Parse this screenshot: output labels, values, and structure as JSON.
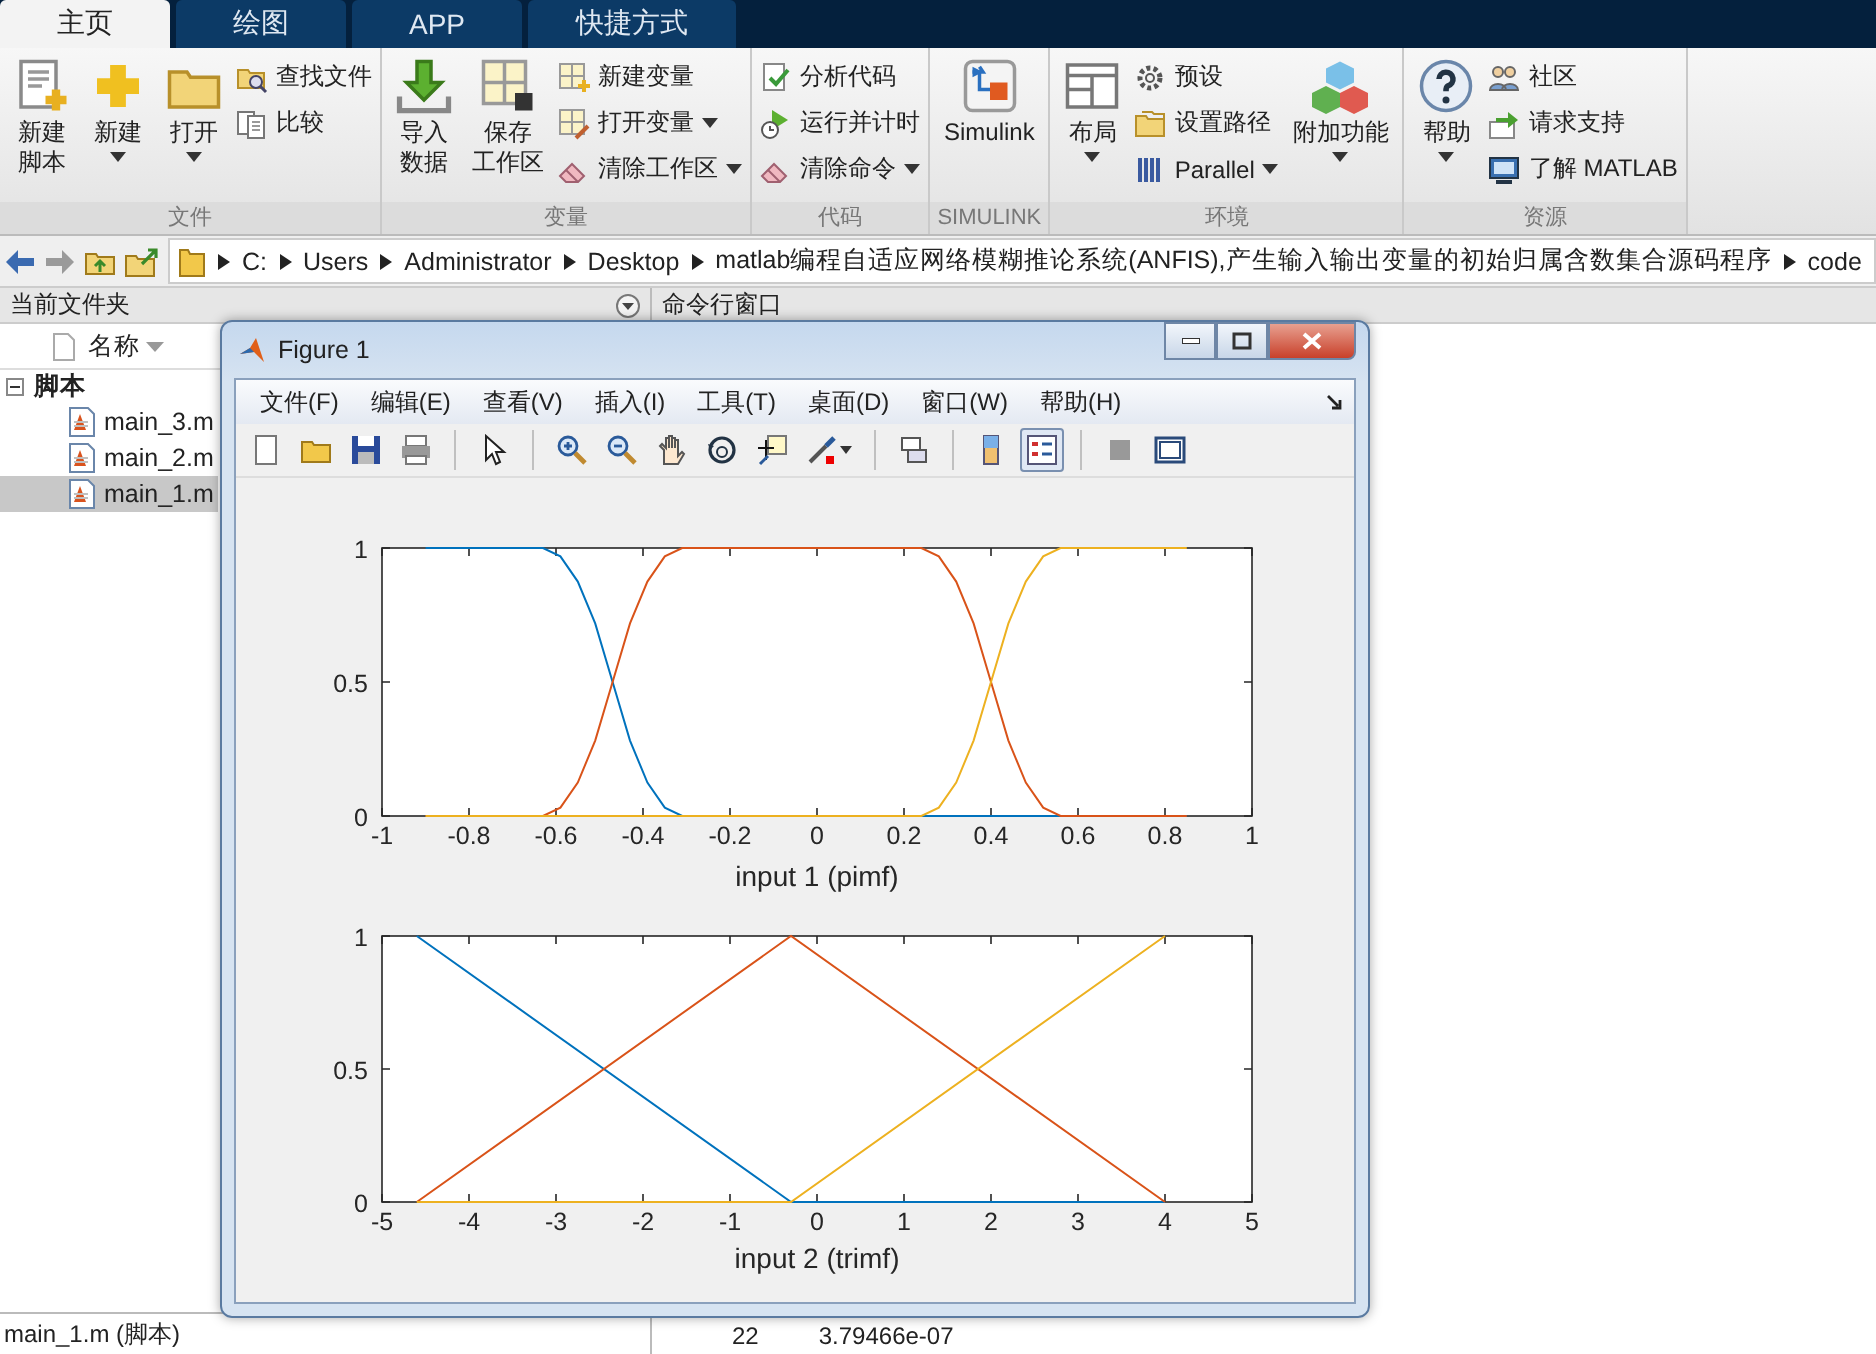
{
  "tabs": [
    {
      "label": "主页",
      "selected": true
    },
    {
      "label": "绘图",
      "selected": false
    },
    {
      "label": "APP",
      "selected": false
    },
    {
      "label": "快捷方式",
      "selected": false
    }
  ],
  "ribbon": [
    {
      "title": "文件",
      "columns": [
        {
          "kind": "large",
          "lines": [
            "新建",
            "脚本"
          ],
          "dropdown": false
        },
        {
          "kind": "large",
          "lines": [
            "新建"
          ],
          "dropdown": true
        },
        {
          "kind": "large",
          "lines": [
            "打开"
          ],
          "dropdown": true
        },
        {
          "kind": "stack",
          "items": [
            {
              "label": "查找文件",
              "dropdown": false
            },
            {
              "label": "比较",
              "dropdown": false
            }
          ]
        }
      ]
    },
    {
      "title": "变量",
      "columns": [
        {
          "kind": "large",
          "lines": [
            "导入",
            "数据"
          ],
          "dropdown": false
        },
        {
          "kind": "large",
          "lines": [
            "保存",
            "工作区"
          ],
          "dropdown": false
        },
        {
          "kind": "stack",
          "items": [
            {
              "label": "新建变量",
              "dropdown": false
            },
            {
              "label": "打开变量",
              "dropdown": true
            },
            {
              "label": "清除工作区",
              "dropdown": true
            }
          ]
        }
      ]
    },
    {
      "title": "代码",
      "columns": [
        {
          "kind": "stack",
          "items": [
            {
              "label": "分析代码",
              "dropdown": false
            },
            {
              "label": "运行并计时",
              "dropdown": false
            },
            {
              "label": "清除命令",
              "dropdown": true
            }
          ]
        }
      ]
    },
    {
      "title": "SIMULINK",
      "columns": [
        {
          "kind": "large",
          "lines": [
            "Simulink"
          ],
          "dropdown": false
        }
      ]
    },
    {
      "title": "环境",
      "columns": [
        {
          "kind": "large",
          "lines": [
            "布局"
          ],
          "dropdown": true
        },
        {
          "kind": "stack",
          "items": [
            {
              "label": "预设",
              "dropdown": false
            },
            {
              "label": "设置路径",
              "dropdown": false
            },
            {
              "label": "Parallel",
              "dropdown": true
            }
          ]
        },
        {
          "kind": "large",
          "lines": [
            "附加功能"
          ],
          "dropdown": true
        }
      ]
    },
    {
      "title": "资源",
      "columns": [
        {
          "kind": "large",
          "lines": [
            "帮助"
          ],
          "dropdown": true
        },
        {
          "kind": "stack",
          "items": [
            {
              "label": "社区",
              "dropdown": false
            },
            {
              "label": "请求支持",
              "dropdown": false
            },
            {
              "label": "了解 MATLAB",
              "dropdown": false
            }
          ]
        }
      ]
    }
  ],
  "address_bar": {
    "path": [
      "C:",
      "Users",
      "Administrator",
      "Desktop",
      "matlab编程自适应网络模糊推论系统(ANFIS),产生输入输出变量的初始归属含数集合源码程序",
      "code"
    ]
  },
  "current_folder": {
    "title": "当前文件夹",
    "column": "名称",
    "tree": [
      {
        "label": "脚本",
        "expanded": true,
        "children": [
          {
            "label": "main_3.m",
            "selected": false
          },
          {
            "label": "main_2.m",
            "selected": false
          },
          {
            "label": "main_1.m",
            "selected": true
          }
        ]
      }
    ],
    "status": "main_1.m  (脚本)"
  },
  "command_window": {
    "title": "命令行窗口",
    "lines": [
      {
        "index": "22",
        "value": "3.79466e-07"
      }
    ]
  },
  "figure": {
    "title": "Figure 1",
    "menu": [
      "文件(F)",
      "编辑(E)",
      "查看(V)",
      "插入(I)",
      "工具(T)",
      "桌面(D)",
      "窗口(W)",
      "帮助(H)"
    ],
    "toolbar": [
      [
        {
          "pressed": false,
          "dropdown": false
        },
        {
          "pressed": false,
          "dropdown": false
        },
        {
          "pressed": false,
          "dropdown": false
        },
        {
          "pressed": false,
          "dropdown": false
        }
      ],
      [
        {
          "pressed": false,
          "dropdown": false
        }
      ],
      [
        {
          "pressed": false,
          "dropdown": false
        },
        {
          "pressed": false,
          "dropdown": false
        },
        {
          "pressed": false,
          "dropdown": false
        },
        {
          "pressed": false,
          "dropdown": false
        },
        {
          "pressed": false,
          "dropdown": false
        },
        {
          "pressed": false,
          "dropdown": true
        }
      ],
      [
        {
          "pressed": false,
          "dropdown": false
        }
      ],
      [
        {
          "pressed": false,
          "dropdown": false
        },
        {
          "pressed": true,
          "dropdown": false
        }
      ],
      [
        {
          "pressed": false,
          "dropdown": false
        },
        {
          "pressed": false,
          "dropdown": false
        }
      ]
    ],
    "axes": [
      {
        "chart_data": {
          "type": "line",
          "xlabel": "input 1 (pimf)",
          "xlim": [
            -1,
            1
          ],
          "ylim": [
            0,
            1
          ],
          "xticks": [
            -1,
            -0.8,
            -0.6,
            -0.4,
            -0.2,
            0,
            0.2,
            0.4,
            0.6,
            0.8,
            1
          ],
          "yticks": [
            0,
            0.5,
            1
          ],
          "x": [
            -0.9,
            -0.63,
            -0.59,
            -0.55,
            -0.51,
            -0.47,
            -0.43,
            -0.39,
            -0.35,
            -0.31,
            0.24,
            0.28,
            0.32,
            0.36,
            0.4,
            0.44,
            0.48,
            0.52,
            0.56,
            0.85
          ],
          "series": [
            {
              "color": "#0072bd",
              "values": [
                1,
                1,
                0.969,
                0.875,
                0.719,
                0.5,
                0.281,
                0.125,
                0.031,
                0,
                0,
                0,
                0,
                0,
                0,
                0,
                0,
                0,
                0,
                0
              ]
            },
            {
              "color": "#d95319",
              "values": [
                0,
                0,
                0.031,
                0.125,
                0.281,
                0.5,
                0.719,
                0.875,
                0.969,
                1,
                1,
                0.969,
                0.875,
                0.719,
                0.5,
                0.281,
                0.125,
                0.031,
                0,
                0
              ]
            },
            {
              "color": "#edb120",
              "values": [
                0,
                0,
                0,
                0,
                0,
                0,
                0,
                0,
                0,
                0,
                0,
                0.031,
                0.125,
                0.281,
                0.5,
                0.719,
                0.875,
                0.969,
                1,
                1
              ]
            }
          ]
        }
      },
      {
        "chart_data": {
          "type": "line",
          "xlabel": "input 2 (trimf)",
          "xlim": [
            -5,
            5
          ],
          "ylim": [
            0,
            1
          ],
          "xticks": [
            -5,
            -4,
            -3,
            -2,
            -1,
            0,
            1,
            2,
            3,
            4,
            5
          ],
          "yticks": [
            0,
            0.5,
            1
          ],
          "x": [
            -4.6,
            -0.3,
            4
          ],
          "series": [
            {
              "color": "#0072bd",
              "values": [
                1,
                0,
                0
              ]
            },
            {
              "color": "#d95319",
              "values": [
                0,
                1,
                0
              ]
            },
            {
              "color": "#edb120",
              "values": [
                0,
                0,
                1
              ]
            }
          ]
        }
      }
    ]
  }
}
